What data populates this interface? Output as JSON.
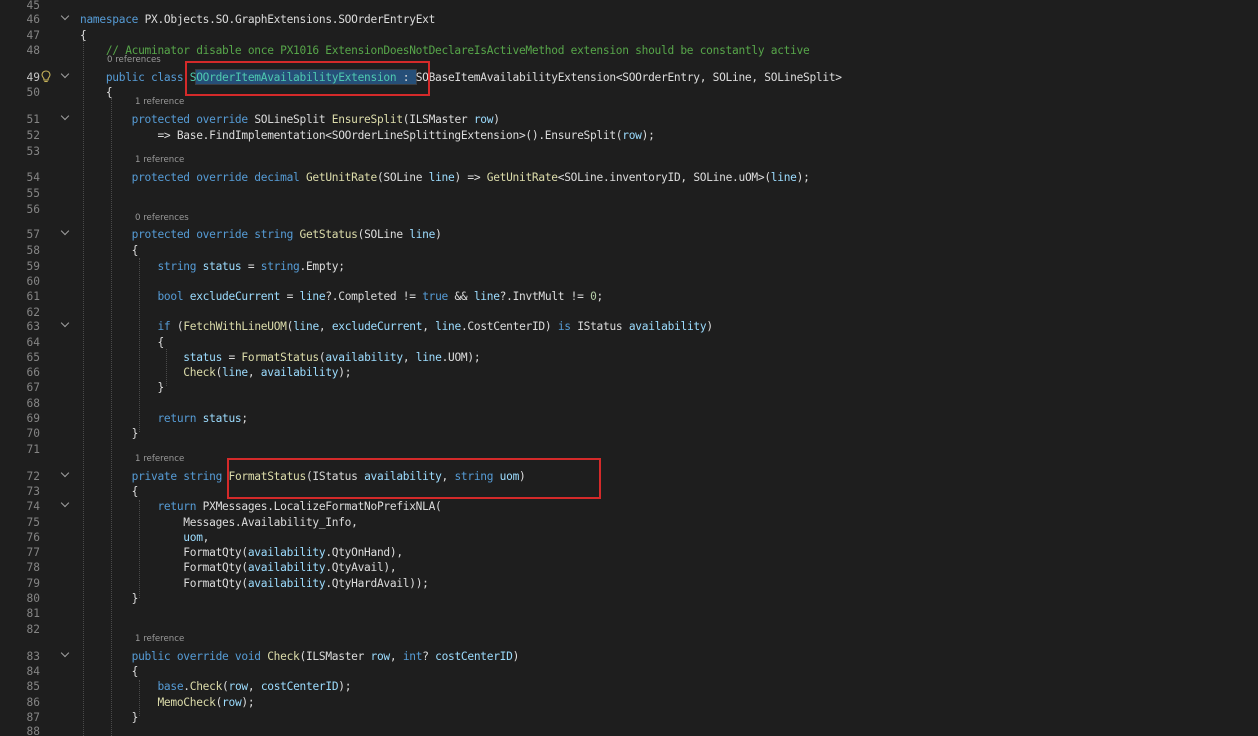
{
  "line_numbers": [
    "45",
    "46",
    "47",
    "48",
    "49",
    "50",
    "51",
    "52",
    "53",
    "54",
    "55",
    "56",
    "57",
    "58",
    "59",
    "60",
    "61",
    "62",
    "63",
    "64",
    "65",
    "66",
    "67",
    "68",
    "69",
    "70",
    "71",
    "72",
    "73",
    "74",
    "75",
    "76",
    "77",
    "78",
    "79",
    "80",
    "81",
    "82",
    "83",
    "84",
    "85",
    "86",
    "87",
    "88"
  ],
  "active_line": "49",
  "codelens": {
    "l49": "0 references",
    "l51": "1 reference",
    "l54": "1 reference",
    "l57": "0 references",
    "l72": "1 reference",
    "l83": "1 reference"
  },
  "code": {
    "l46": [
      [
        "kw",
        "namespace"
      ],
      [
        "pl",
        " PX.Objects.SO.GraphExtensions.SOOrderEntryExt"
      ]
    ],
    "l47": [
      [
        "pl",
        "{"
      ]
    ],
    "l48": [
      [
        "cm",
        "    // Acuminator disable once PX1016 ExtensionDoesNotDeclareIsActiveMethod extension should be constantly active"
      ]
    ],
    "l49": [
      [
        "kw",
        "    public class "
      ],
      [
        "cl",
        "SOOrderItemAvailabilityExtension"
      ],
      [
        "pl",
        " : SOBaseItemAvailabilityExtension<SOOrderEntry, SOLine, SOLineSplit>"
      ]
    ],
    "l50": [
      [
        "pl",
        "    {"
      ]
    ],
    "l51": [
      [
        "kw",
        "        protected override "
      ],
      [
        "pl",
        "SOLineSplit "
      ],
      [
        "fn",
        "EnsureSplit"
      ],
      [
        "pl",
        "(ILSMaster "
      ],
      [
        "pa",
        "row"
      ],
      [
        "pl",
        ")"
      ]
    ],
    "l52": [
      [
        "pl",
        "            => Base.FindImplementation<SOOrderLineSplittingExtension>().EnsureSplit("
      ],
      [
        "pa",
        "row"
      ],
      [
        "pl",
        ");"
      ]
    ],
    "l54": [
      [
        "kw",
        "        protected override decimal "
      ],
      [
        "fn",
        "GetUnitRate"
      ],
      [
        "pl",
        "(SOLine "
      ],
      [
        "pa",
        "line"
      ],
      [
        "pl",
        ") => "
      ],
      [
        "fn",
        "GetUnitRate"
      ],
      [
        "pl",
        "<SOLine.inventoryID, SOLine.uOM>("
      ],
      [
        "pa",
        "line"
      ],
      [
        "pl",
        ");"
      ]
    ],
    "l57": [
      [
        "kw",
        "        protected override string "
      ],
      [
        "fn",
        "GetStatus"
      ],
      [
        "pl",
        "(SOLine "
      ],
      [
        "pa",
        "line"
      ],
      [
        "pl",
        ")"
      ]
    ],
    "l58": [
      [
        "pl",
        "        {"
      ]
    ],
    "l59": [
      [
        "kw",
        "            string "
      ],
      [
        "lo",
        "status"
      ],
      [
        "pl",
        " = "
      ],
      [
        "kw",
        "string"
      ],
      [
        "pl",
        ".Empty;"
      ]
    ],
    "l61": [
      [
        "kw",
        "            bool "
      ],
      [
        "lo",
        "excludeCurrent"
      ],
      [
        "pl",
        " = "
      ],
      [
        "pa",
        "line"
      ],
      [
        "pl",
        "?.Completed != "
      ],
      [
        "kw",
        "true"
      ],
      [
        "pl",
        " && "
      ],
      [
        "pa",
        "line"
      ],
      [
        "pl",
        "?.InvtMult != "
      ],
      [
        "nu",
        "0"
      ],
      [
        "pl",
        ";"
      ]
    ],
    "l63": [
      [
        "kw",
        "            if "
      ],
      [
        "pl",
        "("
      ],
      [
        "fn",
        "FetchWithLineUOM"
      ],
      [
        "pl",
        "("
      ],
      [
        "pa",
        "line"
      ],
      [
        "pl",
        ", "
      ],
      [
        "lo",
        "excludeCurrent"
      ],
      [
        "pl",
        ", "
      ],
      [
        "pa",
        "line"
      ],
      [
        "pl",
        ".CostCenterID) "
      ],
      [
        "kw",
        "is"
      ],
      [
        "pl",
        " IStatus "
      ],
      [
        "lo",
        "availability"
      ],
      [
        "pl",
        ")"
      ]
    ],
    "l64": [
      [
        "pl",
        "            {"
      ]
    ],
    "l65": [
      [
        "lo",
        "                status"
      ],
      [
        "pl",
        " = "
      ],
      [
        "fn",
        "FormatStatus"
      ],
      [
        "pl",
        "("
      ],
      [
        "lo",
        "availability"
      ],
      [
        "pl",
        ", "
      ],
      [
        "pa",
        "line"
      ],
      [
        "pl",
        ".UOM);"
      ]
    ],
    "l66": [
      [
        "fn",
        "                Check"
      ],
      [
        "pl",
        "("
      ],
      [
        "pa",
        "line"
      ],
      [
        "pl",
        ", "
      ],
      [
        "lo",
        "availability"
      ],
      [
        "pl",
        ");"
      ]
    ],
    "l67": [
      [
        "pl",
        "            }"
      ]
    ],
    "l69": [
      [
        "kw",
        "            return "
      ],
      [
        "lo",
        "status"
      ],
      [
        "pl",
        ";"
      ]
    ],
    "l70": [
      [
        "pl",
        "        }"
      ]
    ],
    "l72": [
      [
        "kw",
        "        private string "
      ],
      [
        "fn",
        "FormatStatus"
      ],
      [
        "pl",
        "(IStatus "
      ],
      [
        "pa",
        "availability"
      ],
      [
        "pl",
        ", "
      ],
      [
        "kw",
        "string "
      ],
      [
        "pa",
        "uom"
      ],
      [
        "pl",
        ")"
      ]
    ],
    "l73": [
      [
        "pl",
        "        {"
      ]
    ],
    "l74": [
      [
        "kw",
        "            return "
      ],
      [
        "pl",
        "PXMessages.LocalizeFormatNoPrefixNLA("
      ]
    ],
    "l75": [
      [
        "pl",
        "                Messages.Availability_Info,"
      ]
    ],
    "l76": [
      [
        "pa",
        "                uom"
      ],
      [
        "pl",
        ","
      ]
    ],
    "l77": [
      [
        "pl",
        "                FormatQty("
      ],
      [
        "pa",
        "availability"
      ],
      [
        "pl",
        ".QtyOnHand),"
      ]
    ],
    "l78": [
      [
        "pl",
        "                FormatQty("
      ],
      [
        "pa",
        "availability"
      ],
      [
        "pl",
        ".QtyAvail),"
      ]
    ],
    "l79": [
      [
        "pl",
        "                FormatQty("
      ],
      [
        "pa",
        "availability"
      ],
      [
        "pl",
        ".QtyHardAvail));"
      ]
    ],
    "l80": [
      [
        "pl",
        "        }"
      ]
    ],
    "l83": [
      [
        "kw",
        "        public override void "
      ],
      [
        "fn",
        "Check"
      ],
      [
        "pl",
        "(ILSMaster "
      ],
      [
        "pa",
        "row"
      ],
      [
        "pl",
        ", "
      ],
      [
        "kw",
        "int"
      ],
      [
        "pl",
        "? "
      ],
      [
        "pa",
        "costCenterID"
      ],
      [
        "pl",
        ")"
      ]
    ],
    "l84": [
      [
        "pl",
        "        {"
      ]
    ],
    "l85": [
      [
        "kw",
        "            base"
      ],
      [
        "pl",
        "."
      ],
      [
        "fn",
        "Check"
      ],
      [
        "pl",
        "("
      ],
      [
        "pa",
        "row"
      ],
      [
        "pl",
        ", "
      ],
      [
        "pa",
        "costCenterID"
      ],
      [
        "pl",
        ");"
      ]
    ],
    "l86": [
      [
        "fn",
        "            MemoCheck"
      ],
      [
        "pl",
        "("
      ],
      [
        "pa",
        "row"
      ],
      [
        "pl",
        ");"
      ]
    ],
    "l87": [
      [
        "pl",
        "        }"
      ]
    ]
  }
}
